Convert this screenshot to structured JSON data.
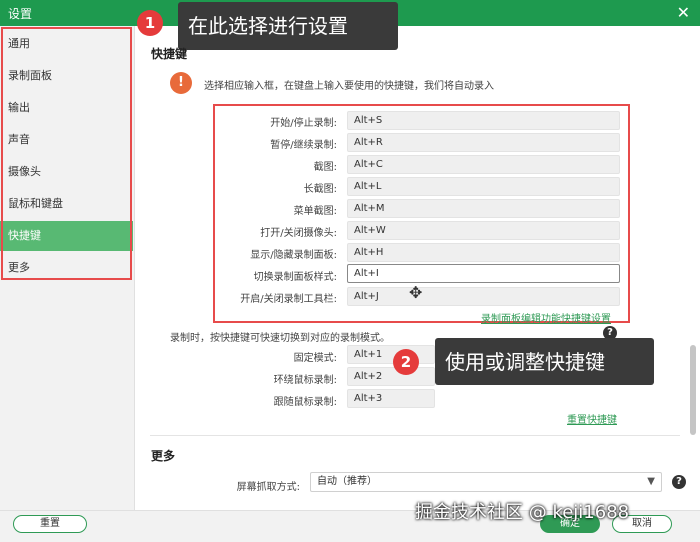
{
  "window": {
    "title": "设置",
    "close_glyph": "✕"
  },
  "sidebar": {
    "items": [
      {
        "label": "通用"
      },
      {
        "label": "录制面板"
      },
      {
        "label": "输出"
      },
      {
        "label": "声音"
      },
      {
        "label": "摄像头"
      },
      {
        "label": "鼠标和键盘"
      },
      {
        "label": "快捷键",
        "active": true
      },
      {
        "label": "更多"
      }
    ]
  },
  "callouts": [
    {
      "number": "1",
      "text": "在此选择进行设置"
    },
    {
      "number": "2",
      "text": "使用或调整快捷键"
    }
  ],
  "hotkeys": {
    "section_title": "快捷键",
    "hint_icon": "!",
    "hint": "选择相应输入框，在键盘上输入要使用的快捷键，我们将自动录入",
    "rows": [
      {
        "label": "开始/停止录制:",
        "value": "Alt+S"
      },
      {
        "label": "暂停/继续录制:",
        "value": "Alt+R"
      },
      {
        "label": "截图:",
        "value": "Alt+C"
      },
      {
        "label": "长截图:",
        "value": "Alt+L"
      },
      {
        "label": "菜单截图:",
        "value": "Alt+M"
      },
      {
        "label": "打开/关闭摄像头:",
        "value": "Alt+W"
      },
      {
        "label": "显示/隐藏录制面板:",
        "value": "Alt+H"
      },
      {
        "label": "切换录制面板样式:",
        "value": "Alt+I",
        "focused": true
      },
      {
        "label": "开启/关闭录制工具栏:",
        "value": "Alt+J"
      }
    ],
    "panel_link": "录制面板编辑功能快捷键设置"
  },
  "modes": {
    "hint": "录制时，按快捷键可快速切换到对应的录制模式。",
    "help_icon": "?",
    "rows": [
      {
        "label": "固定模式:",
        "value": "Alt+1"
      },
      {
        "label": "环绕鼠标录制:",
        "value": "Alt+2"
      },
      {
        "label": "跟随鼠标录制:",
        "value": "Alt+3"
      }
    ],
    "reset_link": "重置快捷键"
  },
  "more": {
    "title": "更多",
    "capture_label": "屏幕抓取方式:",
    "capture_value": "自动（推荐）",
    "help_icon": "?"
  },
  "footer": {
    "reset": "重置",
    "ok": "确定",
    "cancel": "取消"
  },
  "watermark": "掘金技术社区 @ keji1688",
  "colors": {
    "titlebar": "#1e9a4f",
    "active": "#58b973",
    "highlight": "#e74b4b",
    "link": "#2f9a55"
  }
}
